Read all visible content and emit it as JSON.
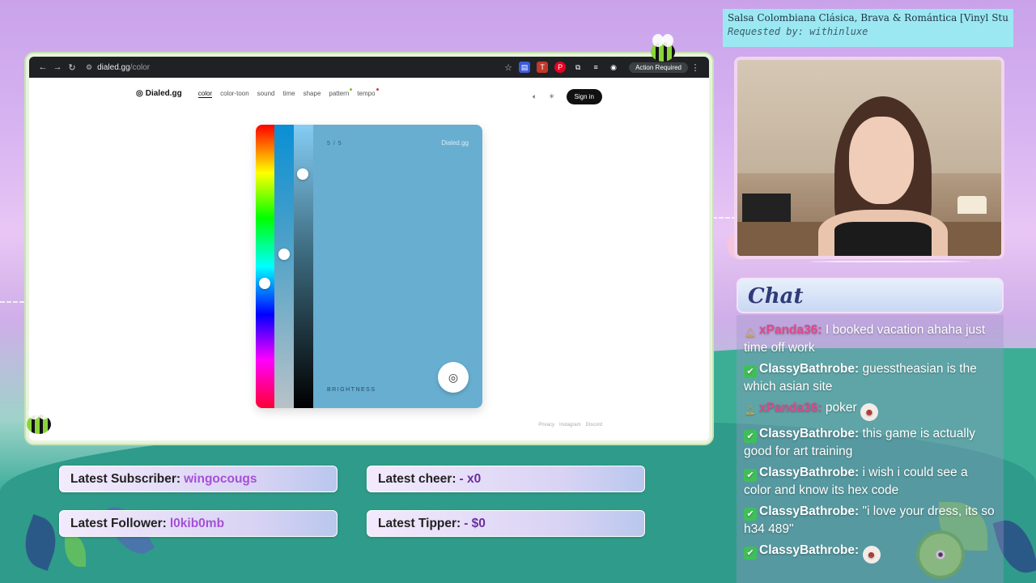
{
  "browser": {
    "url_host": "dialed.gg",
    "url_path": "/color",
    "action_required": "Action Required"
  },
  "site": {
    "logo": "Dialed.gg",
    "nav": [
      "color",
      "color-toon",
      "sound",
      "time",
      "shape",
      "pattern",
      "tempo"
    ],
    "active_nav": "color",
    "sign_in": "Sign in",
    "step": "5 / 5",
    "brand": "Dialed.gg",
    "slider_label": "BRIGHTNESS",
    "preview_color": "#68aed0",
    "footer": [
      "Privacy",
      "Instagram",
      "Discord"
    ]
  },
  "song": {
    "title": "Salsa Colombiana Clásica, Brava & Romántica [Vinyl Studi…",
    "requested": "Requested by: withinluxe"
  },
  "chat": {
    "title": "Chat",
    "messages": [
      {
        "badge": "pin",
        "user": "xPanda36:",
        "text": "I booked vacation ahaha just time off work",
        "color": "#e0488e",
        "emote": ""
      },
      {
        "badge": "check",
        "user": "ClassyBathrobe:",
        "text": "guesstheasian is the which asian site",
        "color": "#ffffff",
        "emote": ""
      },
      {
        "badge": "pin",
        "user": "xPanda36:",
        "text": "poker",
        "color": "#e0488e",
        "emote": "face"
      },
      {
        "badge": "check",
        "user": "ClassyBathrobe:",
        "text": "this game is actually good for art training",
        "color": "#ffffff",
        "emote": ""
      },
      {
        "badge": "check",
        "user": "ClassyBathrobe:",
        "text": "i wish i could see a color and know its hex code",
        "color": "#ffffff",
        "emote": ""
      },
      {
        "badge": "check",
        "user": "ClassyBathrobe:",
        "text": "\"i love your dress, its so h34 489\"",
        "color": "#ffffff",
        "emote": ""
      },
      {
        "badge": "check",
        "user": "ClassyBathrobe:",
        "text": "",
        "color": "#ffffff",
        "emote": "face"
      }
    ]
  },
  "stats": {
    "subscriber_label": "Latest Subscriber:",
    "subscriber": "wingocougs",
    "cheer_label": "Latest cheer:",
    "cheer": " - x0",
    "follower_label": "Latest Follower:",
    "follower": "l0kib0mb",
    "tipper_label": "Latest Tipper:",
    "tipper": " - $0"
  }
}
